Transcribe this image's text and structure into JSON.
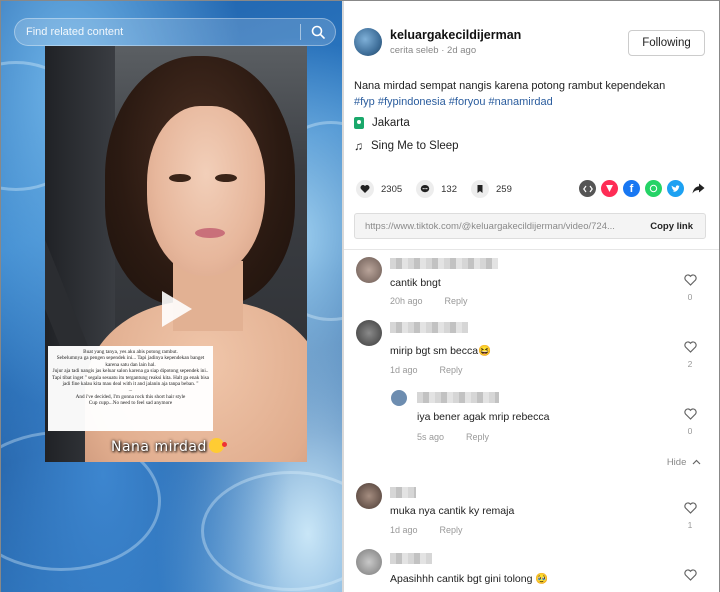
{
  "search": {
    "placeholder": "Find related content"
  },
  "video": {
    "caption_lines": [
      "Buat yang tanya, yes aku abis potong rambut.",
      "Sebelumnya ga pengen sependek ini... Tapi jadinya kependekan banget karena satu dan lain hal.",
      "Jujur aja tadi nangis jas keluar salon karena ga siap dipotong sependek ini..",
      "Tapi tibat inget \" segala sesuatu itu tergantung reaksi kita. Halt ga enak bisa jadi fine kalau kita mau deal with it and jalanin aja tanpa beban. \"",
      "...",
      "And i've decided, I'm gonna rock this short hair style",
      "Cup cupp...No need to feel sad anymore"
    ],
    "name_overlay": "Nana mirdad"
  },
  "post": {
    "username": "keluargakecildijerman",
    "category": "cerita seleb",
    "time": "2d ago",
    "follow_label": "Following",
    "description": "Nana mirdad sempat nangis karena potong rambut kependekan",
    "hashtags": "#fyp #fypindonesia #foryou #nanamirdad",
    "location": "Jakarta",
    "music": "Sing Me to Sleep",
    "likes": "2305",
    "comments": "132",
    "saves": "259",
    "url": "https://www.tiktok.com/@keluargakecildijerman/video/724...",
    "copy_label": "Copy link"
  },
  "colors": {
    "accent": "#fe2c55",
    "tag": "#2b5d9e",
    "location": "#1aa86b"
  },
  "comments": [
    {
      "text": "cantik bngt",
      "time": "20h ago",
      "reply": "Reply",
      "likes": "0"
    },
    {
      "text": "mirip bgt sm becca😆",
      "time": "1d ago",
      "reply": "Reply",
      "likes": "2"
    },
    {
      "text": "iya bener agak mrip rebecca",
      "time": "5s ago",
      "reply": "Reply",
      "likes": "0"
    },
    {
      "text": "muka nya cantik ky remaja",
      "time": "1d ago",
      "reply": "Reply",
      "likes": "1"
    },
    {
      "text": "Apasihhh cantik bgt gini tolong 🥹",
      "time": "",
      "reply": "",
      "likes": ""
    }
  ],
  "hide_label": "Hide"
}
